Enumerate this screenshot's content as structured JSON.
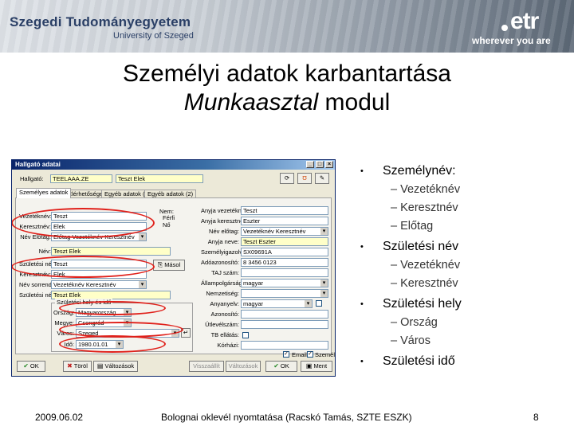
{
  "header": {
    "university": "Szegedi Tudományegyetem",
    "university_en": "University of Szeged",
    "logo": "etr",
    "tagline": "wherever you are"
  },
  "slide": {
    "title_line1": "Személyi adatok karbantartása",
    "title_line2_italic": "Munkaasztal",
    "title_line2_rest": " modul"
  },
  "dialog": {
    "title": "Hallgató adatai",
    "hallgato_label": "Hallgató:",
    "hallgato_code": "TEELAAA.ZE",
    "hallgato_name": "Teszt Elek",
    "tabs": [
      "Személyes adatok",
      "Elérhetőségek",
      "Egyéb adatok (1)",
      "Egyéb adatok (2)"
    ],
    "left_fields": [
      {
        "label": "Vezetéknév:",
        "value": "Teszt"
      },
      {
        "label": "Keresztnév:",
        "value": "Elek"
      },
      {
        "label": "Név Előtag:",
        "value": "Előtag Vezetéknév Keresztnév"
      },
      {
        "label": "Név:",
        "value": "Teszt Elek"
      },
      {
        "label": "Születési név:",
        "value": "Teszt"
      },
      {
        "label": "Keresztnév:",
        "value": "Elek"
      },
      {
        "label": "Név sorrend:",
        "value": "Vezetéknév Keresztnév"
      },
      {
        "label": "Születési név:",
        "value": "Teszt Elek"
      }
    ],
    "nem": {
      "label": "Nem:",
      "options": [
        "Férfi",
        "Nő"
      ]
    },
    "copy_button": "Másol",
    "birth_group": {
      "title": "Születési hely és idő",
      "orszag_label": "Ország:",
      "orszag_value": "Magyarország",
      "megye_label": "Megye:",
      "megye_value": "Csongrád",
      "varos_label": "Város:",
      "varos_value": "Szeged",
      "ido_label": "Idő:",
      "ido_value": "1980.01.01"
    },
    "right_fields": [
      {
        "label": "Anyja vezetékneve:",
        "value": "Teszt"
      },
      {
        "label": "Anyja keresztneve:",
        "value": "Eszter"
      },
      {
        "label": "Név előtag:",
        "value": "Vezetéknév Keresztnév"
      },
      {
        "label": "Anyja neve:",
        "value": "Teszt Eszter"
      },
      {
        "label": "Személyigazolvány:",
        "value": "SX09691A"
      },
      {
        "label": "Adóazonosító:",
        "value": "8 3456 0123"
      },
      {
        "label": "TAJ szám:",
        "value": ""
      },
      {
        "label": "Állampolgárság:",
        "value": "magyar"
      },
      {
        "label": "Nemzetiség:",
        "value": ""
      },
      {
        "label": "Anyanyelv:",
        "value": "magyar"
      },
      {
        "label": "Azonosító:",
        "value": ""
      },
      {
        "label": "Útlevélszám:",
        "value": ""
      },
      {
        "label": "TB ellátás:",
        "value": ""
      },
      {
        "label": "Kórházi:",
        "value": ""
      }
    ],
    "checkbox_label": "Email",
    "checkbox2_label": "Személy",
    "buttons": {
      "ok": "OK",
      "cancel": "Töröl",
      "history": "Változások",
      "prev": "Visszaállít",
      "apply": "Ment"
    }
  },
  "bullets": [
    {
      "text": "Személynév:",
      "sub": [
        "Vezetéknév",
        "Keresztnév",
        "Előtag"
      ]
    },
    {
      "text": "Születési név",
      "sub": [
        "Vezetéknév",
        "Keresztnév"
      ]
    },
    {
      "text": "Születési hely",
      "sub": [
        "Ország",
        "Város"
      ]
    },
    {
      "text": "Születési idő",
      "sub": []
    }
  ],
  "footer": {
    "date": "2009.06.02",
    "center": "Bolognai oklevél nyomtatása (Racskó Tamás, SZTE ESZK)",
    "page": "8"
  },
  "colors": {
    "annotation": "#e0201a",
    "title_bar": "#0a246a",
    "header_text": "#2a3f66"
  }
}
